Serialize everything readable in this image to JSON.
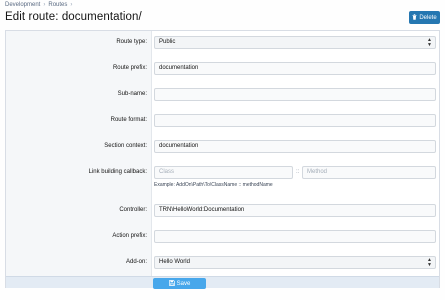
{
  "breadcrumb": [
    "Development",
    "Routes"
  ],
  "page_title": "Edit route: documentation/",
  "delete_button": "Delete",
  "fields": {
    "route_type": {
      "label": "Route type:",
      "value": "Public"
    },
    "route_prefix": {
      "label": "Route prefix:",
      "value": "documentation"
    },
    "sub_name": {
      "label": "Sub-name:",
      "value": ""
    },
    "route_format": {
      "label": "Route format:",
      "value": ""
    },
    "section_context": {
      "label": "Section context:",
      "value": "documentation"
    },
    "link_callback": {
      "label": "Link building callback:",
      "class_placeholder": "Class",
      "separator": "::",
      "method_placeholder": "Method",
      "hint": "Example: AddOn\\Path\\To\\ClassName :: methodName"
    },
    "controller": {
      "label": "Controller:",
      "value": "TRN\\HelloWorld:Documentation"
    },
    "action_prefix": {
      "label": "Action prefix:",
      "value": ""
    },
    "addon": {
      "label": "Add-on:",
      "value": "Hello World"
    }
  },
  "save_button": "Save",
  "colors": {
    "primary": "#2577b1",
    "save": "#47a7eb",
    "footer": "#e3ebf4"
  }
}
